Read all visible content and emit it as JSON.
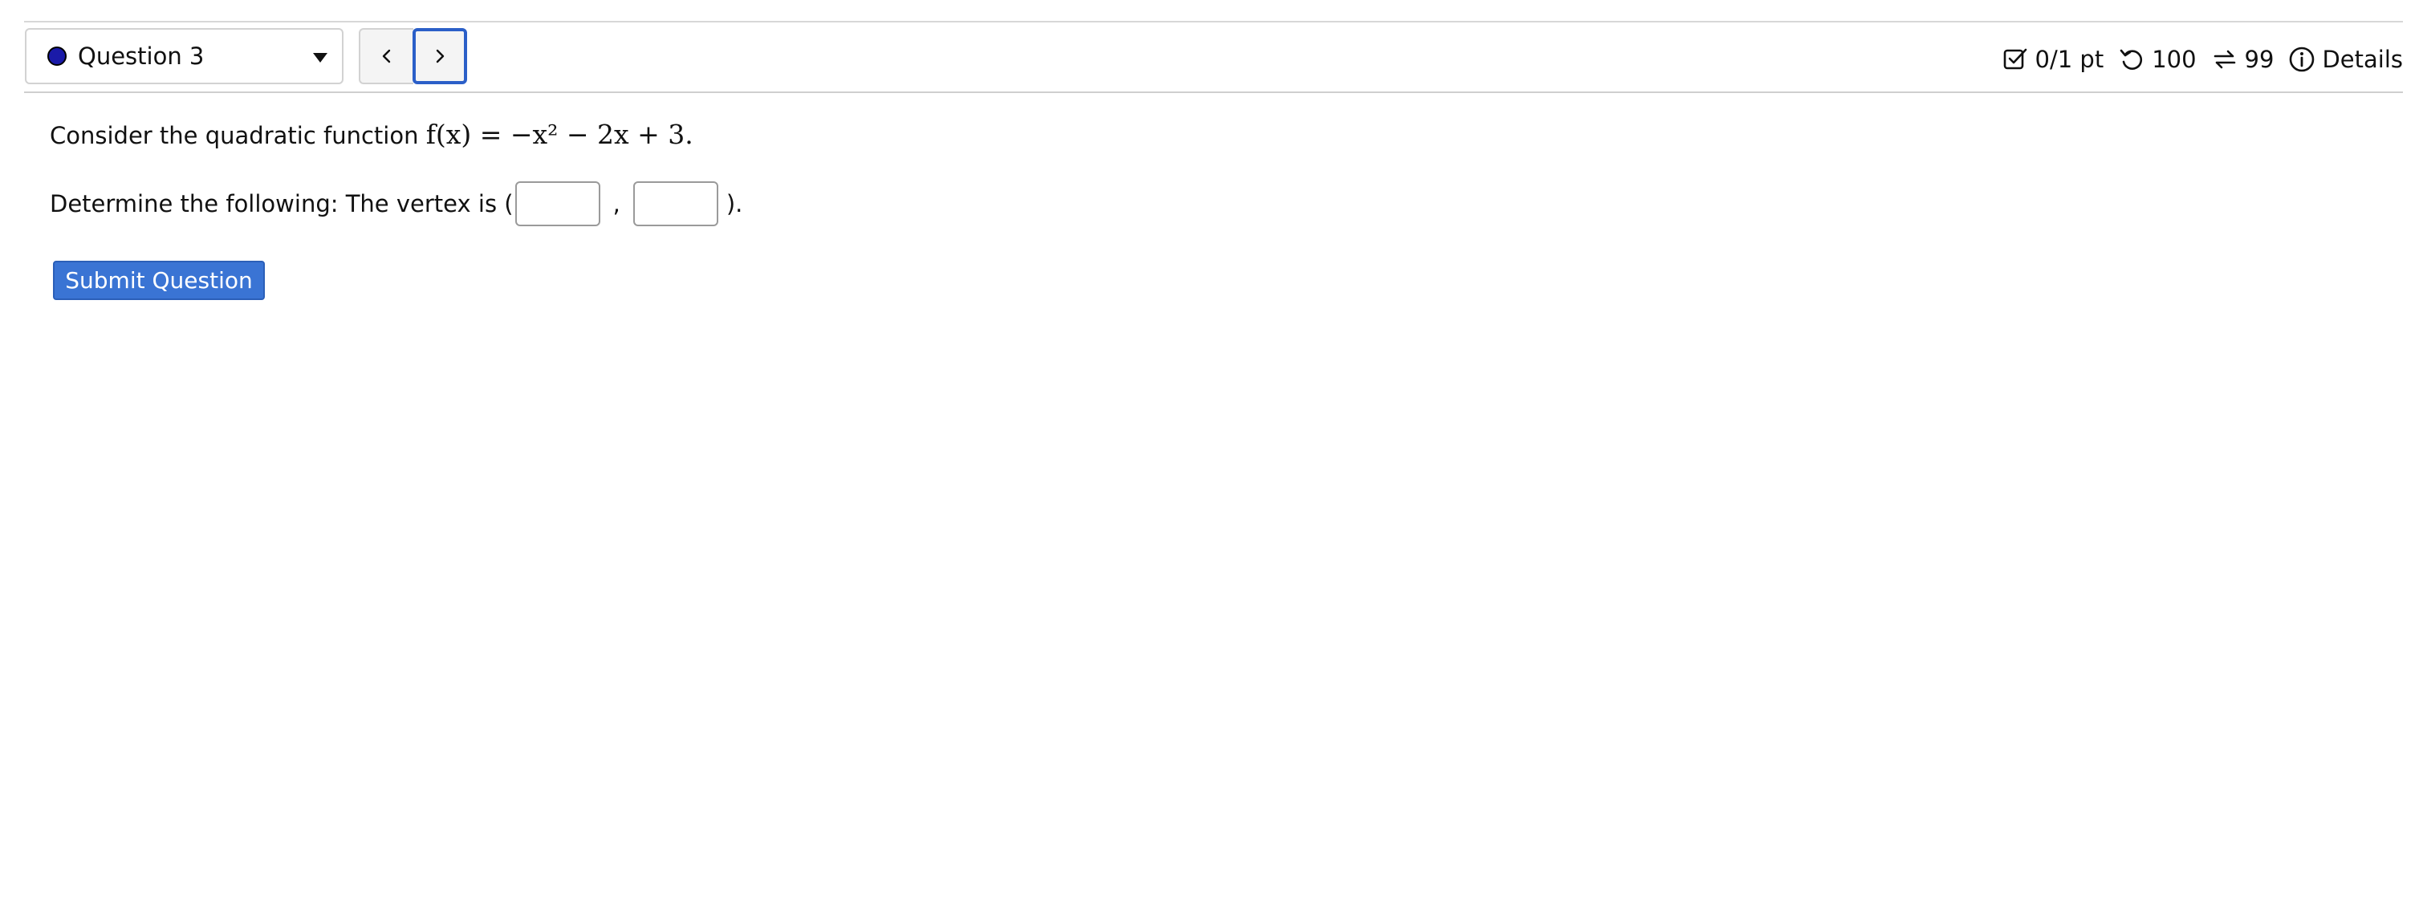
{
  "question_selector": {
    "label": "Question 3",
    "status_color": "#1a1aa8"
  },
  "navigation": {
    "prev_icon": "chevron-left-icon",
    "next_icon": "chevron-right-icon"
  },
  "status_bar": {
    "points": "0/1 pt",
    "attempts": "100",
    "tries": "99",
    "details_label": "Details"
  },
  "question": {
    "intro_text": "Consider the quadratic function",
    "function_expression": "f(x) = −x² − 2x + 3.",
    "prompt_text": "Determine the following: The vertex is (",
    "separator": ",",
    "closing": ").",
    "vertex_x_value": "",
    "vertex_y_value": ""
  },
  "submit_button": {
    "label": "Submit Question",
    "color": "#3a74d4"
  }
}
